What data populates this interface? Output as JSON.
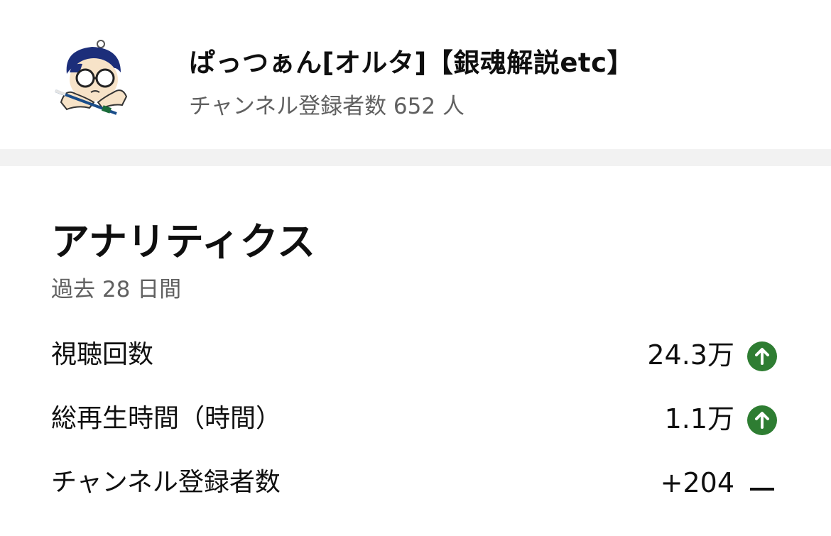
{
  "channel": {
    "name": "ぱっつぁん[オルタ]【銀魂解説etc】",
    "subscribers_line": "チャンネル登録者数 652 人",
    "avatar_icon": "channel-avatar-icon"
  },
  "analytics": {
    "title": "アナリティクス",
    "period": "過去 28 日間",
    "metrics": [
      {
        "label": "視聴回数",
        "value": "24.3万",
        "trend": "up",
        "trend_icon": "arrow-up-circle-icon"
      },
      {
        "label": "総再生時間（時間）",
        "value": "1.1万",
        "trend": "up",
        "trend_icon": "arrow-up-circle-icon"
      },
      {
        "label": "チャンネル登録者数",
        "value": "+204",
        "trend": "flat",
        "trend_icon": "dash-icon"
      }
    ]
  },
  "colors": {
    "trend_up": "#2e7d32",
    "secondary_text": "#606060",
    "divider": "#f2f2f2"
  }
}
